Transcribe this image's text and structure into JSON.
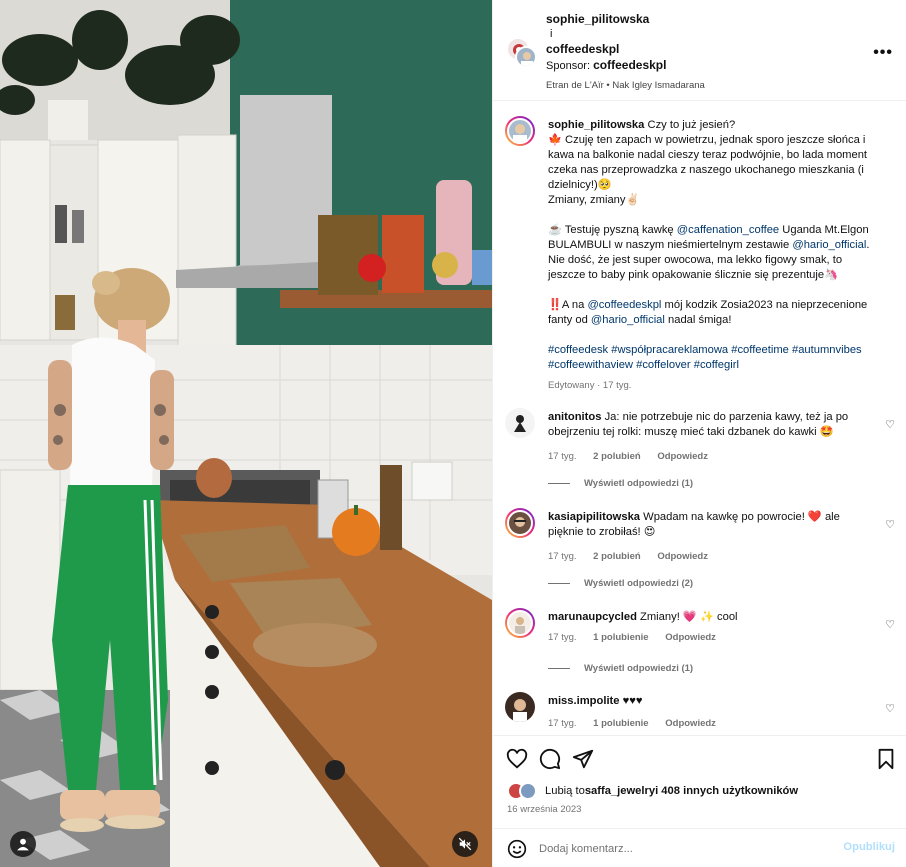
{
  "header": {
    "user1": "sophie_pilitowska",
    "conjunction": "i",
    "user2": "coffeedeskpl",
    "sponsor_label": "Sponsor: ",
    "sponsor_name": "coffeedeskpl",
    "audio": "Etran de L'Aïr • Nak Igley Ismadarana",
    "more_icon": "more-horizontal-icon"
  },
  "caption": {
    "author": "sophie_pilitowska",
    "lines": [
      "Czy to już jesień?",
      "🍁 Czuję ten zapach w powietrzu, jednak sporo jeszcze słońca i kawa na balkonie nadal cieszy teraz podwójnie, bo lada moment czeka nas przeprowadzka z naszego ukochanego mieszkania (i dzielnicy!)🥺",
      "Zmiany, zmiany✌🏻"
    ],
    "p2_a": "☕️ Testuję pyszną kawkę ",
    "p2_tag1": "@caffenation_coffee",
    "p2_b": " Uganda Mt.Elgon BULAMBULI w naszym nieśmiertelnym zestawie ",
    "p2_tag2": "@hario_official",
    "p2_c": ". Nie dość, że jest super owocowa, ma lekko figowy smak, to jeszcze to baby pink opakowanie ślicznie się prezentuje🦄",
    "p3_a": "‼️A na ",
    "p3_tag1": "@coffeedeskpl",
    "p3_b": " mój kodzik Zosia2023 na nieprzecenione fanty od ",
    "p3_tag2": "@hario_official",
    "p3_c": " nadal śmiga!",
    "hashtags": "#coffeedesk #współpracareklamowa #coffeetime #autumnvibes #coffeewithaview #coffelover #coffegirl",
    "edited": "Edytowany · 17 tyg."
  },
  "comments": [
    {
      "author": "anitonitos",
      "text": "Ja: nie potrzebuje nic do parzenia kawy, też ja po obejrzeniu tej rolki: muszę mieć taki dzbanek do kawki 🤩",
      "time": "17 tyg.",
      "likes": "2 polubień",
      "reply": "Odpowiedz",
      "view_replies": "Wyświetl odpowiedzi (1)"
    },
    {
      "author": "kasiapipilitowska",
      "text": "Wpadam na kawkę po powrocie! ❤️  ale pięknie to zrobiłaś! 😍",
      "time": "17 tyg.",
      "likes": "2 polubień",
      "reply": "Odpowiedz",
      "view_replies": "Wyświetl odpowiedzi (2)"
    },
    {
      "author": "marunaupcycled",
      "text": "Zmiany! 💗 ✨ cool",
      "time": "17 tyg.",
      "likes": "1 polubienie",
      "reply": "Odpowiedz",
      "view_replies": "Wyświetl odpowiedzi (1)"
    },
    {
      "author": "miss.impolite",
      "text": "♥♥♥",
      "time": "17 tyg.",
      "likes": "1 polubienie",
      "reply": "Odpowiedz"
    }
  ],
  "likes": {
    "prefix": "Lubią to ",
    "user": "saffa_jewelry",
    "suffix": " i 408 innych użytkowników"
  },
  "date": "16 września 2023",
  "composer": {
    "placeholder": "Dodaj komentarz...",
    "post_label": "Opublikuj"
  },
  "icons": {
    "like": "heart-icon",
    "comment": "comment-icon",
    "share": "paper-plane-icon",
    "save": "bookmark-icon",
    "emoji": "emoji-smile-icon",
    "mute": "muted-speaker-icon",
    "tagged": "user-tag-icon"
  },
  "colors": {
    "link": "#00376b",
    "muted": "#737373",
    "post_disabled": "#b2dffc",
    "wall_green": "#2e6a58",
    "pants_green": "#1f9a4a"
  }
}
